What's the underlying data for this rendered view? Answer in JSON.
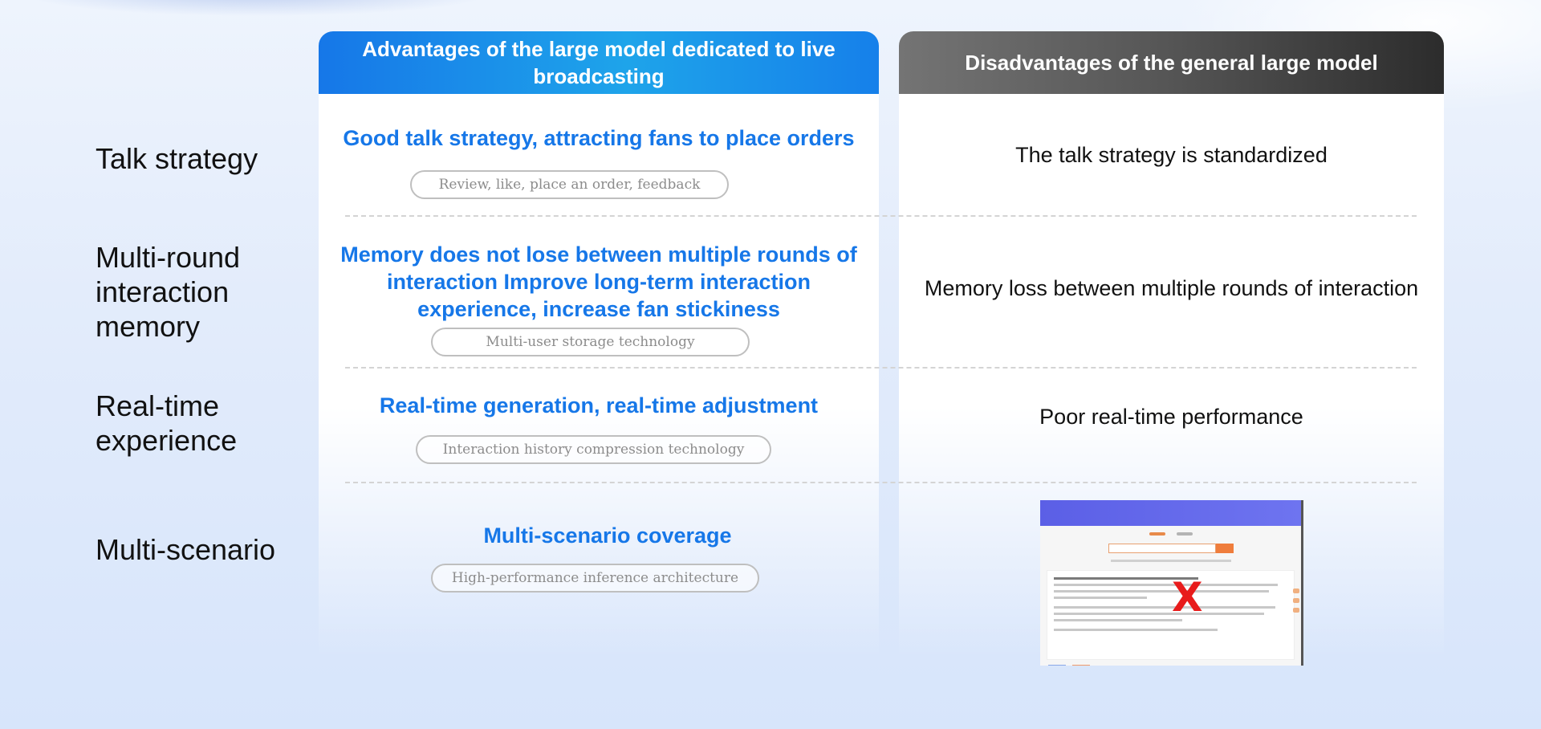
{
  "header": {
    "advantages_title": "Advantages of the large model dedicated to live broadcasting",
    "disadvantages_title": "Disadvantages of the general large model"
  },
  "rows": [
    {
      "label": "Talk strategy",
      "advantage": "Good talk strategy, attracting fans to place orders",
      "tag": "Review, like, place an order, feedback",
      "disadvantage": "The talk strategy is standardized"
    },
    {
      "label": "Multi-round interaction memory",
      "advantage": "Memory does not lose between multiple rounds of interaction Improve long-term interaction experience, increase fan stickiness",
      "tag": "Multi-user storage technology",
      "disadvantage": "Memory loss between multiple rounds of interaction"
    },
    {
      "label": "Real-time experience",
      "advantage": "Real-time generation, real-time adjustment",
      "tag": "Interaction history compression technology",
      "disadvantage": "Poor real-time performance"
    },
    {
      "label": "Multi-scenario",
      "advantage": "Multi-scenario coverage",
      "tag": "High-performance inference architecture",
      "disadvantage_image": {
        "icon": "cross-mark-icon",
        "mark": "X",
        "mark_color": "#e81b1b"
      }
    }
  ],
  "colors": {
    "accent_blue": "#1677e8",
    "header_dark": "#3a3a3a",
    "tag_gray": "#8c8c8c"
  }
}
